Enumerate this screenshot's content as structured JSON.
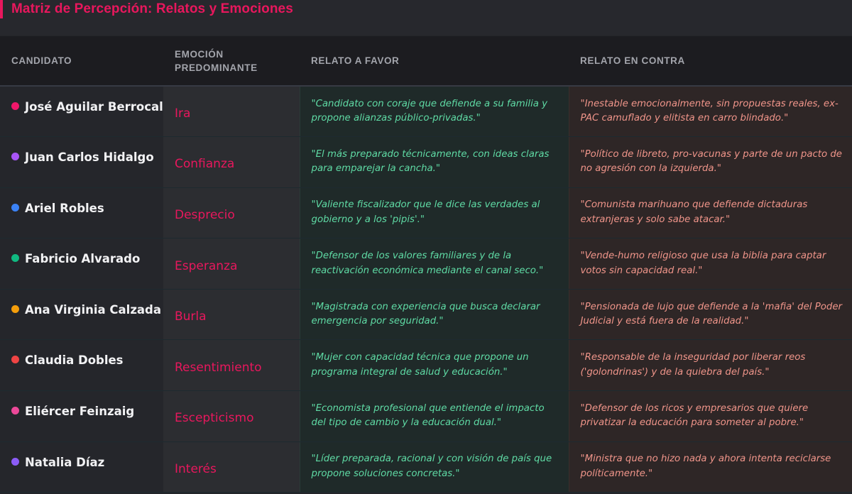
{
  "title": "Matriz de Percepción: Relatos y Emociones",
  "headers": {
    "candidato": "CANDIDATO",
    "emocion_1": "EMOCIÓN",
    "emocion_2": "PREDOMINANTE",
    "favor": "RELATO A FAVOR",
    "contra": "RELATO EN CONTRA"
  },
  "colors": {
    "accent": "#e8175d",
    "favor_text": "#5fdba5",
    "contra_text": "#f0958a"
  },
  "rows": [
    {
      "candidato": "José Aguilar Berrocal",
      "dot_color": "#f0176a",
      "emocion": "Ira",
      "favor": "\"Candidato con coraje que defiende a su familia y propone alianzas público-privadas.\"",
      "contra": "\"Inestable emocionalmente, sin propuestas reales, ex-PAC camuflado y elitista en carro blindado.\""
    },
    {
      "candidato": "Juan Carlos Hidalgo",
      "dot_color": "#a855f7",
      "emocion": "Confianza",
      "favor": "\"El más preparado técnicamente, con ideas claras para emparejar la cancha.\"",
      "contra": "\"Político de libreto, pro-vacunas y parte de un pacto de no agresión con la izquierda.\""
    },
    {
      "candidato": "Ariel Robles",
      "dot_color": "#3b82f6",
      "emocion": "Desprecio",
      "favor": "\"Valiente fiscalizador que le dice las verdades al gobierno y a los 'pipis'.\"",
      "contra": "\"Comunista marihuano que defiende dictaduras extranjeras y solo sabe atacar.\""
    },
    {
      "candidato": "Fabricio Alvarado",
      "dot_color": "#10b981",
      "emocion": "Esperanza",
      "favor": "\"Defensor de los valores familiares y de la reactivación económica mediante el canal seco.\"",
      "contra": "\"Vende-humo religioso que usa la biblia para captar votos sin capacidad real.\""
    },
    {
      "candidato": "Ana Virginia Calzada",
      "dot_color": "#f59e0b",
      "emocion": "Burla",
      "favor": "\"Magistrada con experiencia que busca declarar emergencia por seguridad.\"",
      "contra": "\"Pensionada de lujo que defiende a la 'mafia' del Poder Judicial y está fuera de la realidad.\""
    },
    {
      "candidato": "Claudia Dobles",
      "dot_color": "#ef4444",
      "emocion": "Resentimiento",
      "favor": "\"Mujer con capacidad técnica que propone un programa integral de salud y educación.\"",
      "contra": "\"Responsable de la inseguridad por liberar reos ('golondrinas') y de la quiebra del país.\""
    },
    {
      "candidato": "Eliércer Feinzaig",
      "dot_color": "#ec4899",
      "emocion": "Escepticismo",
      "favor": "\"Economista profesional que entiende el impacto del tipo de cambio y la educación dual.\"",
      "contra": "\"Defensor de los ricos y empresarios que quiere privatizar la educación para someter al pobre.\""
    },
    {
      "candidato": "Natalia Díaz",
      "dot_color": "#8b5cf6",
      "emocion": "Interés",
      "favor": "\"Líder preparada, racional y con visión de país que propone soluciones concretas.\"",
      "contra": "\"Ministra que no hizo nada y ahora intenta reciclarse políticamente.\""
    }
  ]
}
